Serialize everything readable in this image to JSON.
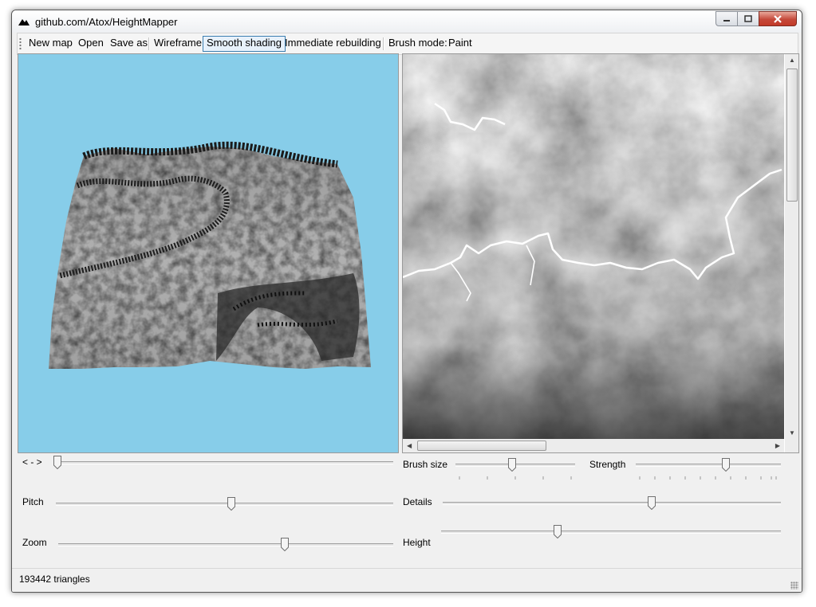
{
  "window": {
    "title": "github.com/Atox/HeightMapper"
  },
  "toolbar": {
    "new_map": "New map",
    "open": "Open",
    "save_as": "Save as",
    "wireframe": "Wireframe",
    "smooth_shading": "Smooth shading",
    "immediate_rebuilding": "Immediate rebuilding",
    "brush_mode_label": "Brush mode:",
    "brush_mode_value": "Paint"
  },
  "controls": {
    "rotate_label": "< - >",
    "pitch_label": "Pitch",
    "zoom_label": "Zoom",
    "brush_size_label": "Brush size",
    "strength_label": "Strength",
    "details_label": "Details",
    "height_label": "Height",
    "rotate_value": 0.0,
    "pitch_value": 0.52,
    "zoom_value": 0.68,
    "brush_size_value": 0.47,
    "strength_value": 0.63,
    "details_value": 0.62,
    "height_value": 0.34
  },
  "status": {
    "triangles": "193442 triangles"
  },
  "icons": [
    "app-icon",
    "minimize-icon",
    "maximize-icon",
    "close-icon",
    "scroll-up-icon",
    "scroll-down-icon",
    "scroll-left-icon",
    "scroll-right-icon",
    "resize-grip-icon"
  ],
  "colors": {
    "sky": "#87cde9",
    "accent": "#3c7fb1"
  }
}
